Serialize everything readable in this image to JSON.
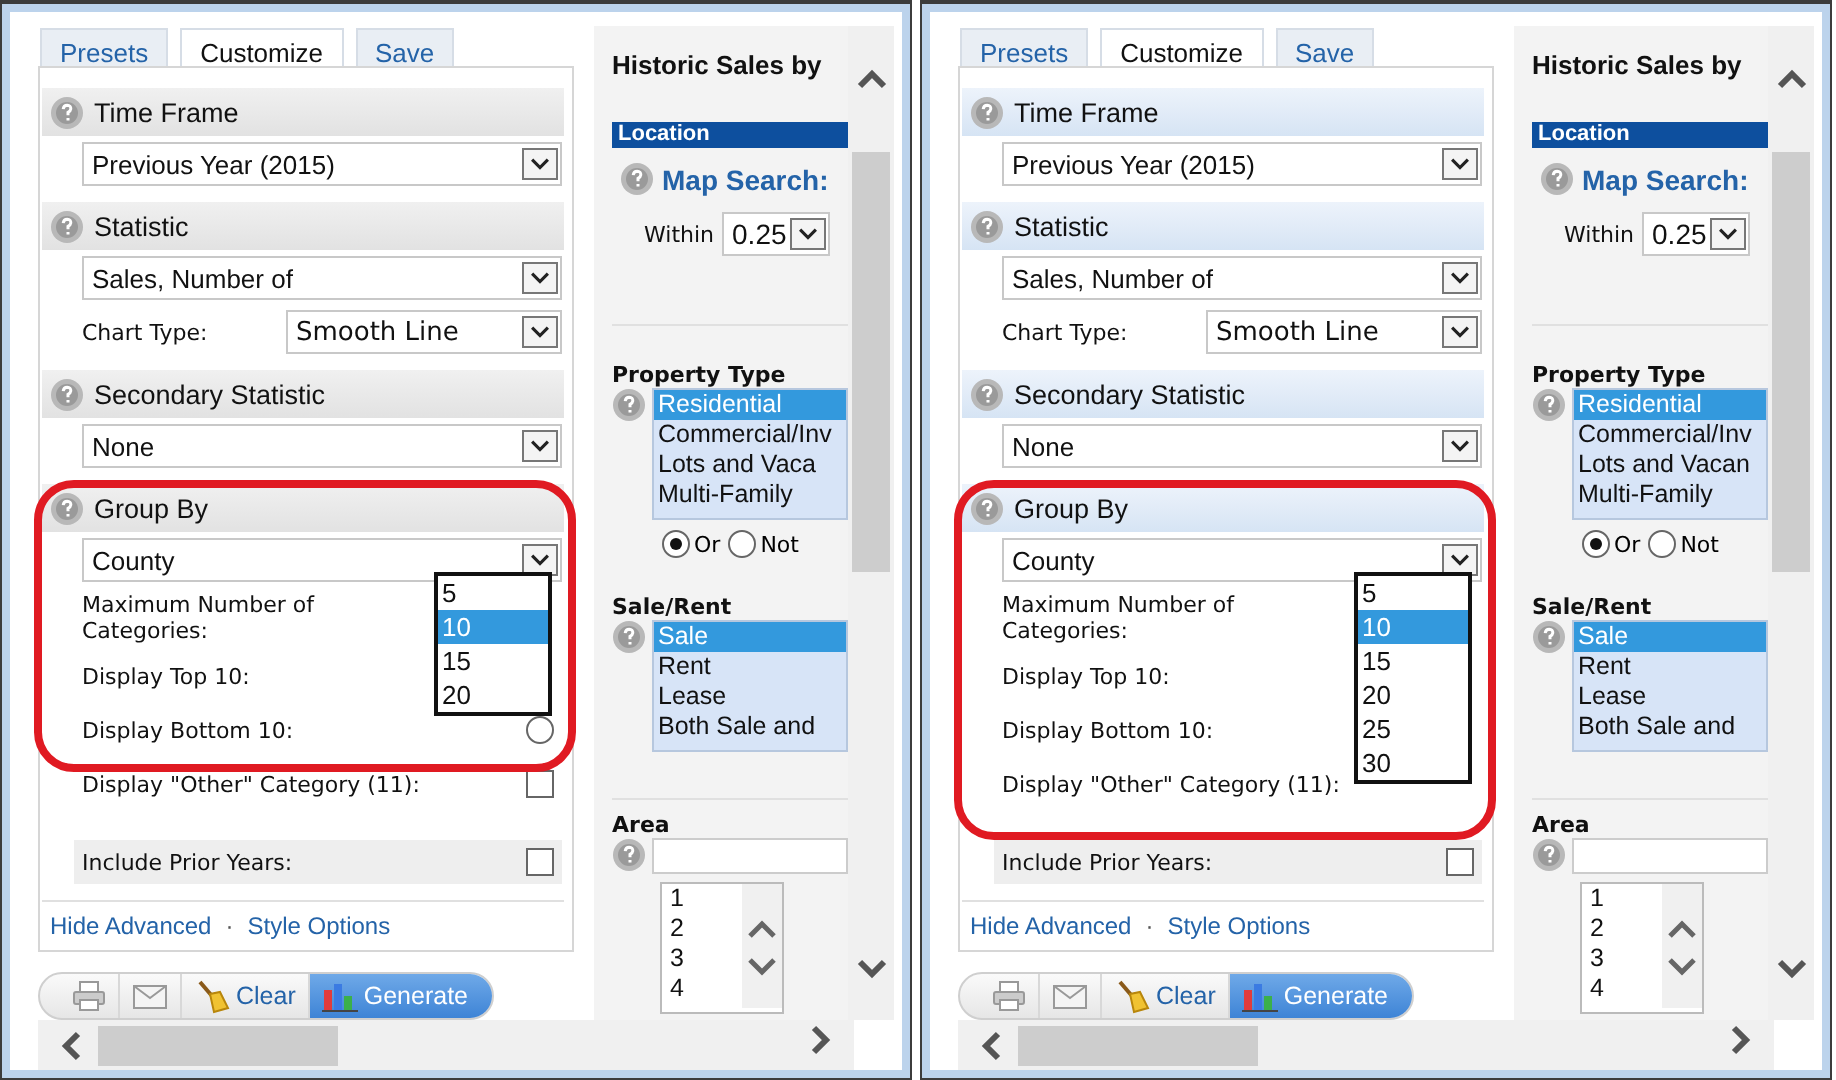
{
  "panels": [
    {
      "kind": "plain",
      "tabs": [
        {
          "label": "Presets",
          "selected": false
        },
        {
          "label": "Customize",
          "selected": true
        },
        {
          "label": "Save",
          "selected": false
        }
      ],
      "sections": [
        {
          "title": "Time Frame",
          "value": "Previous Year (2015)"
        },
        {
          "title": "Statistic",
          "value": "Sales, Number of",
          "chart_type": {
            "label": "Chart Type:",
            "value": "Smooth Line"
          }
        },
        {
          "title": "Secondary Statistic",
          "value": "None"
        },
        {
          "title": "Group By",
          "value": "County",
          "highlighted": true,
          "rows": [
            {
              "kind": "label",
              "label": "Maximum Number of Categories:"
            },
            {
              "kind": "label",
              "label": "Display Top 10:"
            },
            {
              "kind": "radio",
              "label": "Display Bottom 10:",
              "checked": false
            },
            {
              "kind": "checkbox",
              "label": "Display \"Other\" Category (11):",
              "checked": false
            },
            {
              "kind": "checkbox",
              "label": "Include Prior Years:",
              "checked": false,
              "shaded": true
            }
          ],
          "dropdown": [
            {
              "label": "5",
              "selected": false
            },
            {
              "label": "10",
              "selected": true
            },
            {
              "label": "15",
              "selected": false
            },
            {
              "label": "20",
              "selected": false
            }
          ]
        }
      ],
      "links": [
        "Hide Advanced",
        "Style Options"
      ],
      "separator": "·",
      "toolbar": [
        {
          "kind": "print"
        },
        {
          "kind": "mail"
        },
        {
          "kind": "clear",
          "label": "Clear"
        },
        {
          "kind": "generate",
          "label": "Generate"
        }
      ],
      "side": {
        "title": "Historic Sales by",
        "location": "Location",
        "map_search": "Map Search:",
        "within": "Within",
        "within_value": "0.25",
        "property_type": {
          "title": "Property Type",
          "options": [
            {
              "label": "Residential",
              "selected": true
            },
            {
              "label": "Commercial/Inv",
              "selected": false
            },
            {
              "label": "Lots and Vaca",
              "selected": false
            },
            {
              "label": "Multi-Family",
              "selected": false
            }
          ],
          "radios": [
            {
              "label": "Or",
              "selected": true
            },
            {
              "label": "Not",
              "selected": false
            }
          ]
        },
        "sale_rent": {
          "title": "Sale/Rent",
          "options": [
            {
              "label": "Sale",
              "selected": true
            },
            {
              "label": "Rent",
              "selected": false
            },
            {
              "label": "Lease",
              "selected": false
            },
            {
              "label": "Both Sale and",
              "selected": false
            }
          ]
        },
        "area": {
          "title": "Area",
          "items": [
            "1",
            "2",
            "3",
            "4"
          ]
        }
      }
    },
    {
      "kind": "tinted",
      "tabs": [
        {
          "label": "Presets",
          "selected": false
        },
        {
          "label": "Customize",
          "selected": true
        },
        {
          "label": "Save",
          "selected": false
        }
      ],
      "sections": [
        {
          "title": "Time Frame",
          "value": "Previous Year (2015)"
        },
        {
          "title": "Statistic",
          "value": "Sales, Number of",
          "chart_type": {
            "label": "Chart Type:",
            "value": "Smooth Line"
          }
        },
        {
          "title": "Secondary Statistic",
          "value": "None"
        },
        {
          "title": "Group By",
          "value": "County",
          "highlighted": true,
          "rows": [
            {
              "kind": "label",
              "label": "Maximum Number of Categories:"
            },
            {
              "kind": "label",
              "label": "Display Top 10:"
            },
            {
              "kind": "label",
              "label": "Display Bottom 10:"
            },
            {
              "kind": "label",
              "label": "Display \"Other\" Category (11):"
            },
            {
              "kind": "checkbox",
              "label": "Include Prior Years:",
              "checked": false,
              "shaded": true
            }
          ],
          "dropdown": [
            {
              "label": "5",
              "selected": false
            },
            {
              "label": "10",
              "selected": true
            },
            {
              "label": "15",
              "selected": false
            },
            {
              "label": "20",
              "selected": false
            },
            {
              "label": "25",
              "selected": false
            },
            {
              "label": "30",
              "selected": false
            }
          ]
        }
      ],
      "links": [
        "Hide Advanced",
        "Style Options"
      ],
      "separator": "·",
      "toolbar": [
        {
          "kind": "print"
        },
        {
          "kind": "mail"
        },
        {
          "kind": "clear",
          "label": "Clear"
        },
        {
          "kind": "generate",
          "label": "Generate"
        }
      ],
      "side": {
        "title": "Historic Sales by",
        "location": "Location",
        "map_search": "Map Search:",
        "within": "Within",
        "within_value": "0.25",
        "property_type": {
          "title": "Property Type",
          "options": [
            {
              "label": "Residential",
              "selected": true
            },
            {
              "label": "Commercial/Inv",
              "selected": false
            },
            {
              "label": "Lots and Vacan",
              "selected": false
            },
            {
              "label": "Multi-Family",
              "selected": false
            }
          ],
          "radios": [
            {
              "label": "Or",
              "selected": true
            },
            {
              "label": "Not",
              "selected": false
            }
          ]
        },
        "sale_rent": {
          "title": "Sale/Rent",
          "options": [
            {
              "label": "Sale",
              "selected": true
            },
            {
              "label": "Rent",
              "selected": false
            },
            {
              "label": "Lease",
              "selected": false
            },
            {
              "label": "Both Sale and",
              "selected": false
            }
          ]
        },
        "area": {
          "title": "Area",
          "items": [
            "1",
            "2",
            "3",
            "4"
          ]
        }
      }
    }
  ]
}
